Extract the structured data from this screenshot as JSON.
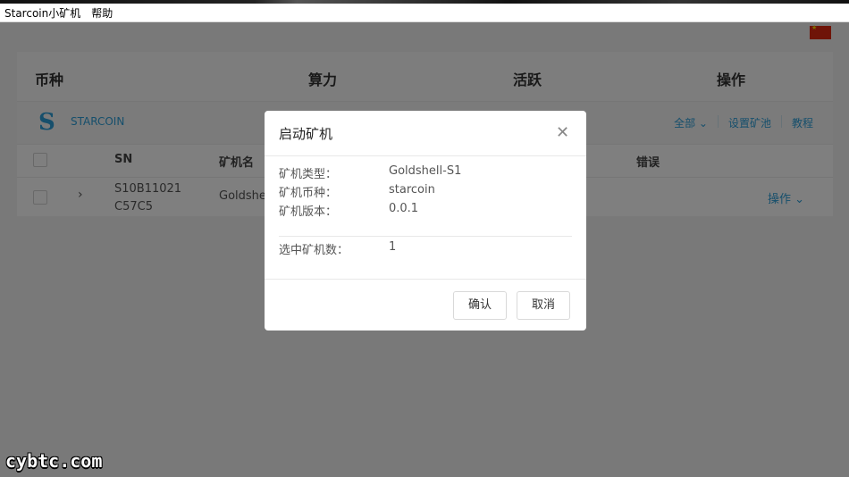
{
  "menu": {
    "app": "Starcoin小矿机",
    "help": "帮助"
  },
  "table": {
    "headers": [
      "币种",
      "算力",
      "活跃",
      "操作"
    ],
    "coin": {
      "name": "STARCOIN",
      "logo": "S"
    },
    "links": [
      "全部",
      "设置矿池",
      "教程"
    ],
    "sub_headers": {
      "sn": "SN",
      "name": "矿机名",
      "errors": "错误"
    },
    "row": {
      "sn_line1": "S10B11021",
      "sn_line2": "C57C5",
      "name": "Goldshell",
      "action": "操作"
    }
  },
  "modal": {
    "title": "启动矿机",
    "fields": [
      {
        "label": "矿机类型：",
        "value": "Goldshell-S1"
      },
      {
        "label": "矿机币种：",
        "value": "starcoin"
      },
      {
        "label": "矿机版本：",
        "value": "0.0.1"
      }
    ],
    "selected": {
      "label": "选中矿机数：",
      "value": "1"
    },
    "confirm": "确认",
    "cancel": "取消"
  },
  "colors": {
    "accent": "#2d9fd8",
    "flag": "#de2910"
  },
  "watermark": "cybtc.com"
}
